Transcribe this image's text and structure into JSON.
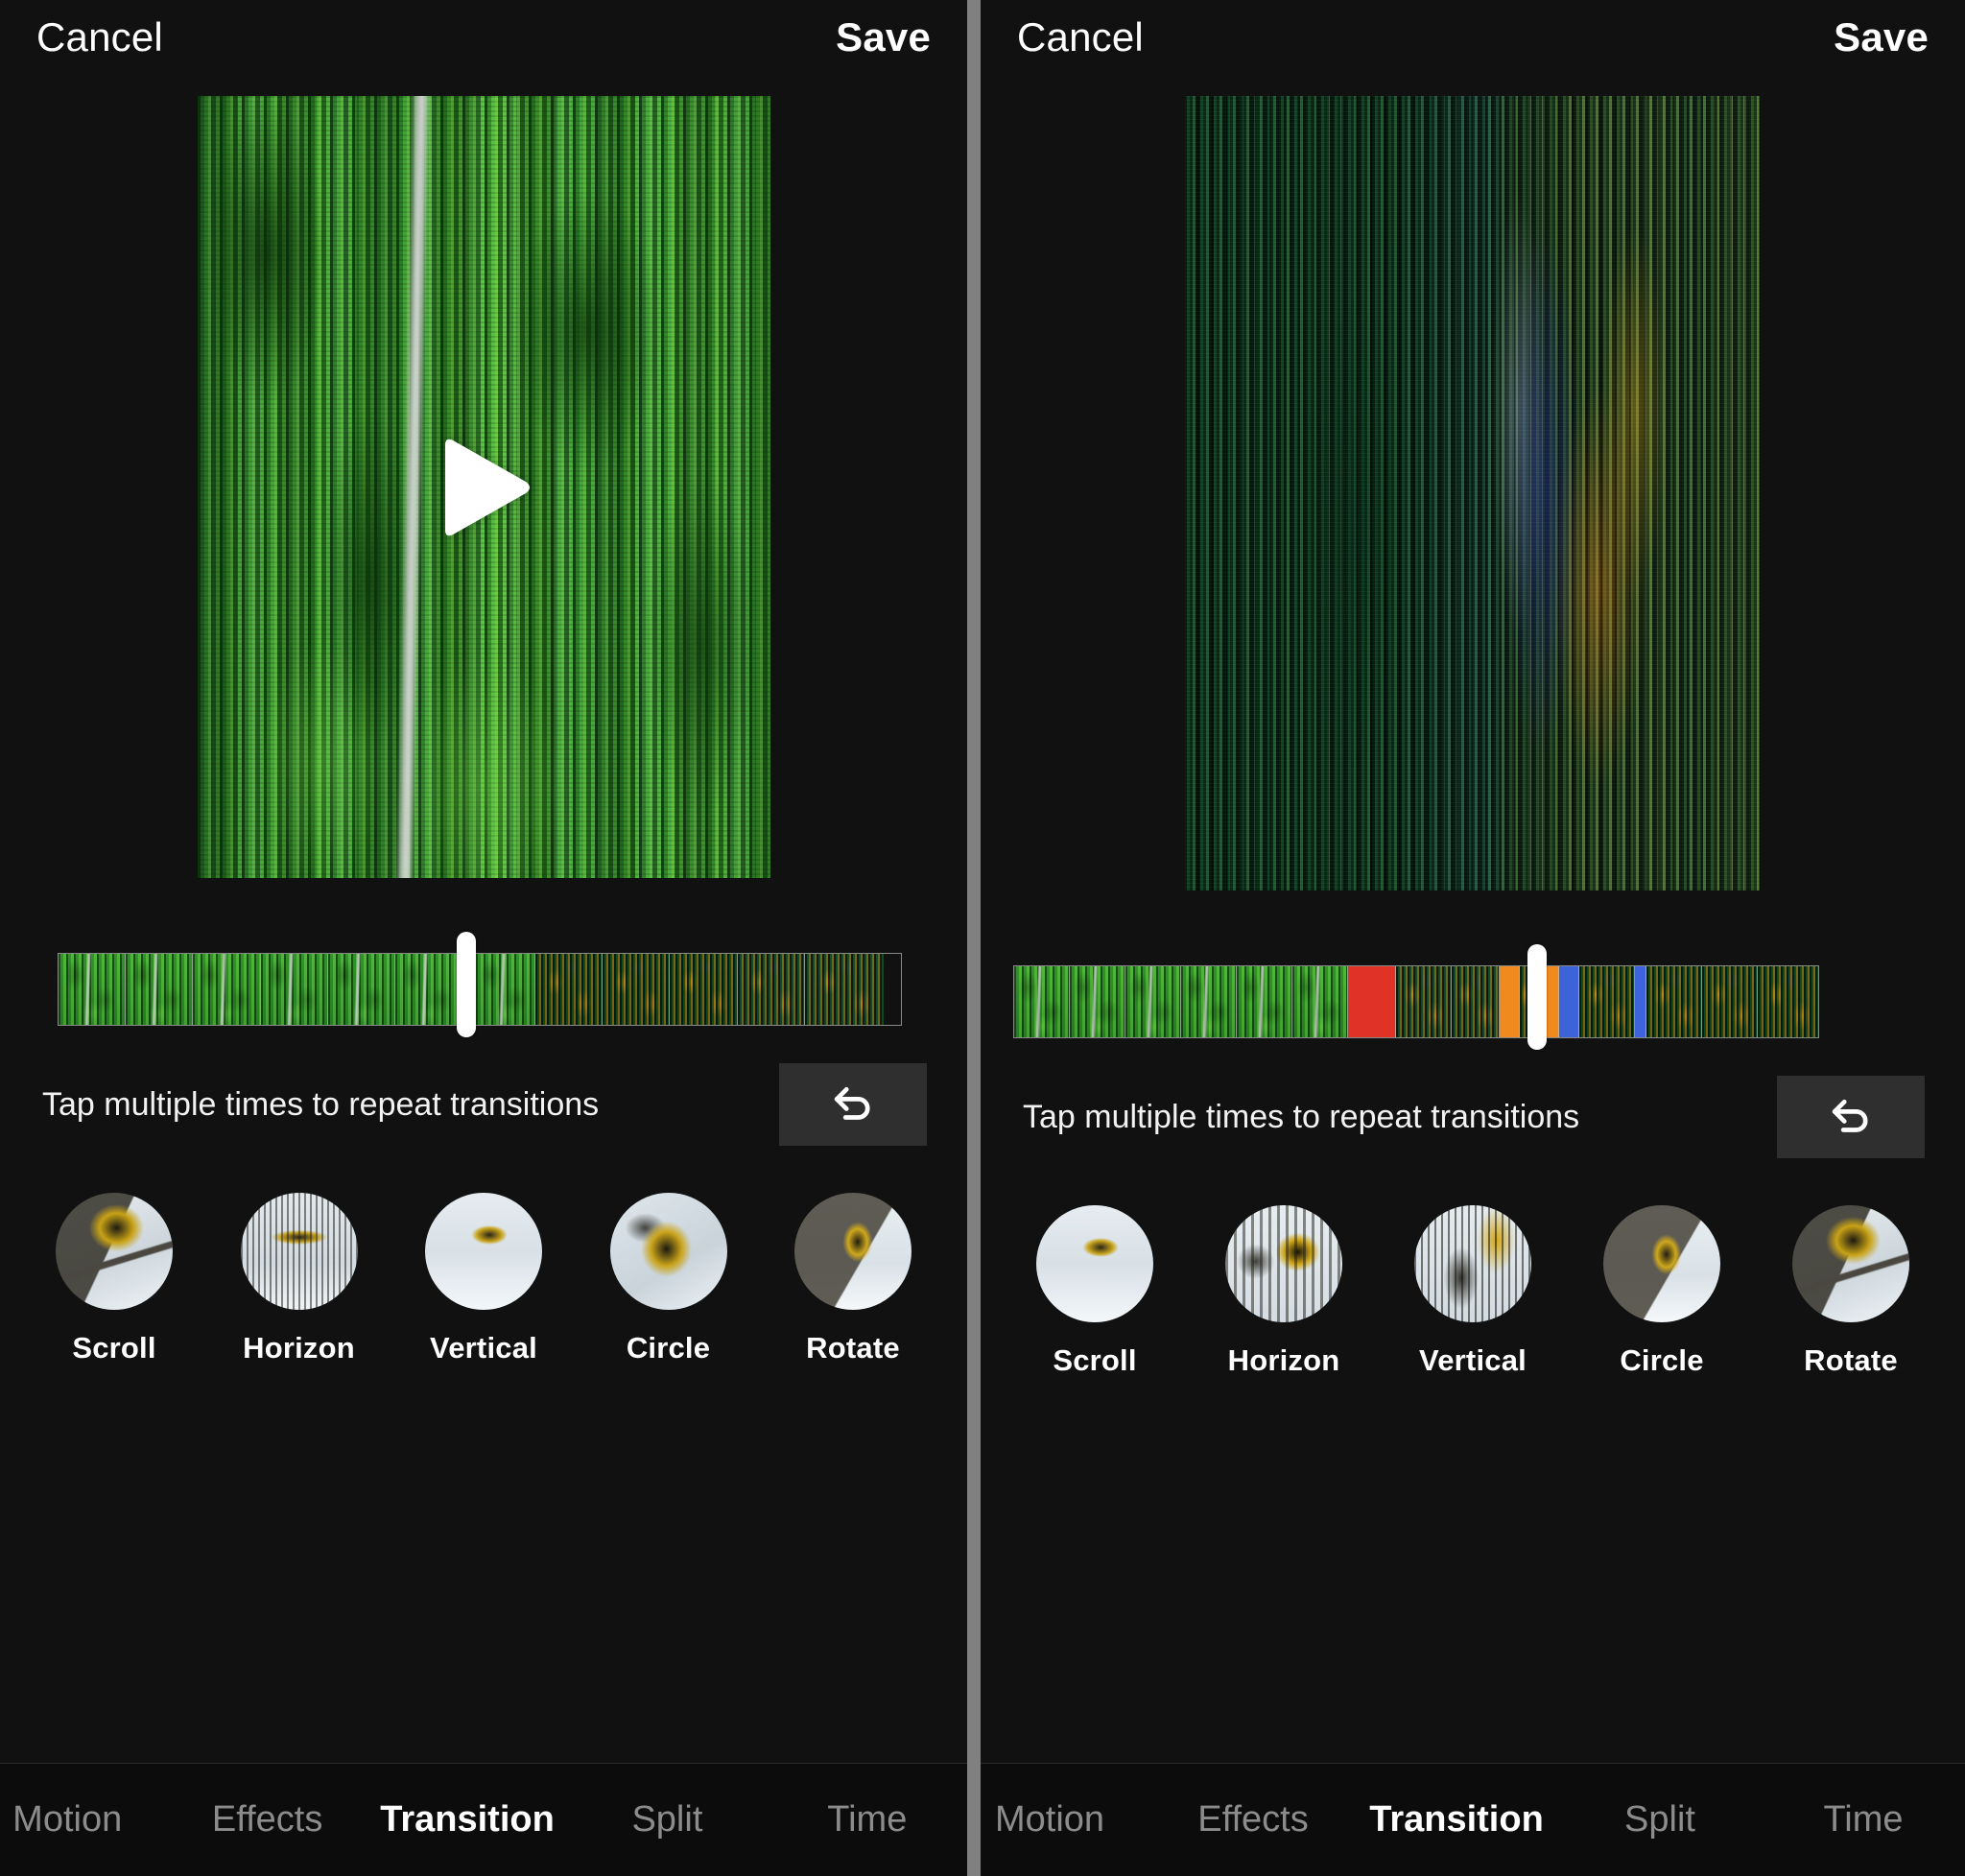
{
  "app": {
    "name": "video-editor-transition-screen",
    "accent_white": "#ffffff",
    "background": "#111111",
    "divider_color": "#808080"
  },
  "panels": [
    {
      "id": "left",
      "header": {
        "cancel_label": "Cancel",
        "save_label": "Save"
      },
      "preview": {
        "state": "paused",
        "play_icon": "play-triangle-icon",
        "content_description": "aerial forest with road, vertical streak effect"
      },
      "timeline": {
        "playhead_percent": 38,
        "segments": [
          {
            "type": "green",
            "width": 8
          },
          {
            "type": "green",
            "width": 8
          },
          {
            "type": "green",
            "width": 8
          },
          {
            "type": "green",
            "width": 8
          },
          {
            "type": "green",
            "width": 8
          },
          {
            "type": "green",
            "width": 8
          },
          {
            "type": "blue",
            "width": 1.6
          },
          {
            "type": "green",
            "width": 7
          },
          {
            "type": "autumn",
            "width": 8
          },
          {
            "type": "autumn",
            "width": 8
          },
          {
            "type": "autumn",
            "width": 8
          },
          {
            "type": "autumn",
            "width": 8
          },
          {
            "type": "autumn",
            "width": 9.4
          }
        ]
      },
      "hint": {
        "text": "Tap multiple times to repeat transitions",
        "undo_icon": "undo-arrow-icon"
      },
      "transitions": [
        {
          "label": "Scroll",
          "art": "t-ski-a"
        },
        {
          "label": "Horizon",
          "art": "t-ski-b"
        },
        {
          "label": "Vertical",
          "art": "t-ski-c"
        },
        {
          "label": "Circle",
          "art": "t-ski-d"
        },
        {
          "label": "Rotate",
          "art": "t-ski-e"
        }
      ],
      "nav": [
        {
          "label": "Motion",
          "active": false
        },
        {
          "label": "Effects",
          "active": false
        },
        {
          "label": "Transition",
          "active": true
        },
        {
          "label": "Split",
          "active": false
        },
        {
          "label": "Time",
          "active": false
        }
      ]
    },
    {
      "id": "right",
      "header": {
        "cancel_label": "Cancel",
        "save_label": "Save"
      },
      "preview": {
        "state": "playing",
        "play_icon": null,
        "content_description": "glitched vertical streak frame, green to orange"
      },
      "timeline": {
        "playhead_percent": 66,
        "segments": [
          {
            "type": "green",
            "width": 7
          },
          {
            "type": "green",
            "width": 7
          },
          {
            "type": "green",
            "width": 7
          },
          {
            "type": "green",
            "width": 7
          },
          {
            "type": "green",
            "width": 7
          },
          {
            "type": "green",
            "width": 7
          },
          {
            "type": "red",
            "width": 6
          },
          {
            "type": "autumn",
            "width": 7
          },
          {
            "type": "autumn",
            "width": 6
          },
          {
            "type": "orange",
            "width": 2.5
          },
          {
            "type": "autumn",
            "width": 2.5
          },
          {
            "type": "orange",
            "width": 2.5
          },
          {
            "type": "blue",
            "width": 2.5
          },
          {
            "type": "autumn",
            "width": 7
          },
          {
            "type": "blue-thin",
            "width": 1.4
          },
          {
            "type": "autumn",
            "width": 7
          },
          {
            "type": "autumn",
            "width": 7
          },
          {
            "type": "autumn",
            "width": 7.6
          }
        ]
      },
      "hint": {
        "text": "Tap multiple times to repeat transitions",
        "undo_icon": "undo-arrow-icon"
      },
      "transitions": [
        {
          "label": "Scroll",
          "art": "t-ski-c"
        },
        {
          "label": "Horizon",
          "art": "t-ski-f"
        },
        {
          "label": "Vertical",
          "art": "t-ski-g"
        },
        {
          "label": "Circle",
          "art": "t-ski-e"
        },
        {
          "label": "Rotate",
          "art": "t-ski-a"
        }
      ],
      "nav": [
        {
          "label": "Motion",
          "active": false
        },
        {
          "label": "Effects",
          "active": false
        },
        {
          "label": "Transition",
          "active": true
        },
        {
          "label": "Split",
          "active": false
        },
        {
          "label": "Time",
          "active": false
        }
      ]
    }
  ]
}
